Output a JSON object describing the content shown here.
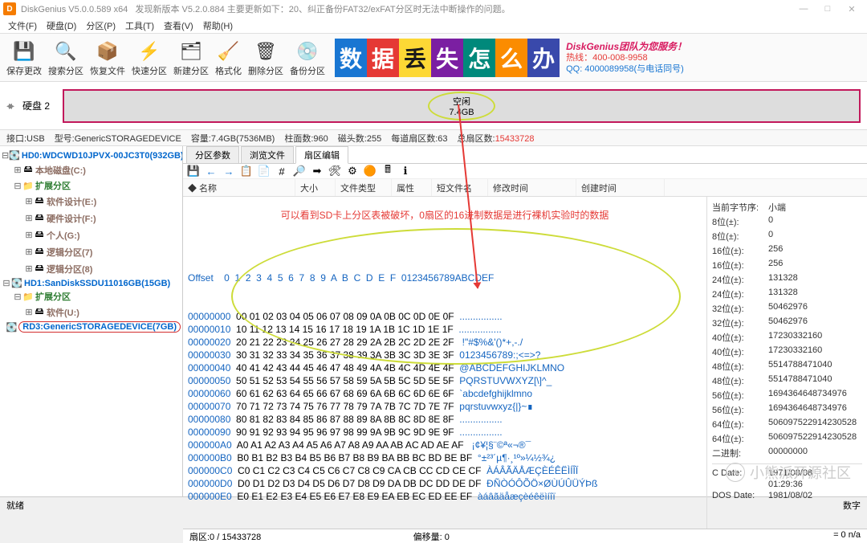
{
  "titlebar": {
    "app": "DiskGenius V5.0.0.589 x64",
    "msg": "发现新版本 V5.2.0.884 主要更新如下：20、纠正备份FAT32/exFAT分区时无法中断操作的问题。"
  },
  "winbtns": {
    "min": "—",
    "max": "□",
    "close": "✕"
  },
  "menu": [
    "文件(F)",
    "硬盘(D)",
    "分区(P)",
    "工具(T)",
    "查看(V)",
    "帮助(H)"
  ],
  "toolbar": [
    {
      "ico": "💾",
      "lbl": "保存更改"
    },
    {
      "ico": "🔍",
      "lbl": "搜索分区"
    },
    {
      "ico": "📦",
      "lbl": "恢复文件"
    },
    {
      "ico": "⚡",
      "lbl": "快速分区"
    },
    {
      "ico": "🗂",
      "lbl": "新建分区"
    },
    {
      "ico": "🧹",
      "lbl": "格式化"
    },
    {
      "ico": "🗑",
      "lbl": "删除分区"
    },
    {
      "ico": "💿",
      "lbl": "备份分区"
    }
  ],
  "banner": {
    "blocks": [
      {
        "bg": "#1976d2",
        "t": "数"
      },
      {
        "bg": "#e53935",
        "t": "据"
      },
      {
        "bg": "#fdd835",
        "t": "丢",
        "fg": "#1a1a1a"
      },
      {
        "bg": "#7b1fa2",
        "t": "失"
      },
      {
        "bg": "#00897b",
        "t": "怎"
      },
      {
        "bg": "#fb8c00",
        "t": "么"
      },
      {
        "bg": "#3949ab",
        "t": "办"
      }
    ],
    "line1": "DiskGenius团队为您服务！",
    "hot": "热线：400-008-9958",
    "qq": "QQ: 4000089958(与电话同号)"
  },
  "diskrow": {
    "label": "硬盘 2",
    "free_t": "空闲",
    "free_s": "7.4GB"
  },
  "infoline": {
    "iface": "接口:USB",
    "model": "型号:GenericSTORAGEDEVICE",
    "cap": "容量:7.4GB(7536MB)",
    "cyl": "柱面数:960",
    "head": "磁头数:255",
    "sec": "每道扇区数:63",
    "tot_l": "总扇区数:",
    "tot_v": "15433728"
  },
  "tree": {
    "hd0": "HD0:WDCWD10JPVX-00JC3T0(932GB)",
    "local": "本地磁盘(C:)",
    "ext1": "扩展分区",
    "e": "软件设计(E:)",
    "f": "硬件设计(F:)",
    "g": "个人(G:)",
    "l7": "逻辑分区(7)",
    "l8": "逻辑分区(8)",
    "hd1": "HD1:SanDiskSSDU11016GB(15GB)",
    "ext2": "扩展分区",
    "u": "软件(U:)",
    "rd3": "RD3:GenericSTORAGEDEVICE(7GB)"
  },
  "tabs": [
    "分区参数",
    "浏览文件",
    "扇区编辑"
  ],
  "cols": [
    "◆ 名称",
    "大小",
    "文件类型",
    "属性",
    "短文件名",
    "修改时间",
    "创建时间"
  ],
  "note": "可以看到SD卡上分区表被破坏，0扇区的16进制数据是进行裸机实验时的数据",
  "hex": {
    "hdr": "Offset    0  1  2  3  4  5  6  7  8  9  A  B  C  D  E  F  0123456789ABCDEF",
    "rows": [
      {
        "o": "00000000",
        "h": "00 01 02 03 04 05 06 07 08 09 0A 0B 0C 0D 0E 0F",
        "a": "................"
      },
      {
        "o": "00000010",
        "h": "10 11 12 13 14 15 16 17 18 19 1A 1B 1C 1D 1E 1F",
        "a": "................"
      },
      {
        "o": "00000020",
        "h": "20 21 22 23 24 25 26 27 28 29 2A 2B 2C 2D 2E 2F",
        "a": " !\"#$%&'()*+,-./"
      },
      {
        "o": "00000030",
        "h": "30 31 32 33 34 35 36 37 38 39 3A 3B 3C 3D 3E 3F",
        "a": "0123456789:;<=>?"
      },
      {
        "o": "00000040",
        "h": "40 41 42 43 44 45 46 47 48 49 4A 4B 4C 4D 4E 4F",
        "a": "@ABCDEFGHIJKLMNO"
      },
      {
        "o": "00000050",
        "h": "50 51 52 53 54 55 56 57 58 59 5A 5B 5C 5D 5E 5F",
        "a": "PQRSTUVWXYZ[\\]^_"
      },
      {
        "o": "00000060",
        "h": "60 61 62 63 64 65 66 67 68 69 6A 6B 6C 6D 6E 6F",
        "a": "`abcdefghijklmno"
      },
      {
        "o": "00000070",
        "h": "70 71 72 73 74 75 76 77 78 79 7A 7B 7C 7D 7E 7F",
        "a": "pqrstuvwxyz{|}~∎"
      },
      {
        "o": "00000080",
        "h": "80 81 82 83 84 85 86 87 88 89 8A 8B 8C 8D 8E 8F",
        "a": "................"
      },
      {
        "o": "00000090",
        "h": "90 91 92 93 94 95 96 97 98 99 9A 9B 9C 9D 9E 9F",
        "a": "................"
      },
      {
        "o": "000000A0",
        "h": "A0 A1 A2 A3 A4 A5 A6 A7 A8 A9 AA AB AC AD AE AF",
        "a": " ¡¢¥¦§¨©ª«¬­®¯"
      },
      {
        "o": "000000B0",
        "h": "B0 B1 B2 B3 B4 B5 B6 B7 B8 B9 BA BB BC BD BE BF",
        "a": "°±²³´µ¶·¸¹º»¼½¾¿"
      },
      {
        "o": "000000C0",
        "h": "C0 C1 C2 C3 C4 C5 C6 C7 C8 C9 CA CB CC CD CE CF",
        "a": "ÀÁÂÃÄÅÆÇÈÉÊËÌÍÎÏ"
      },
      {
        "o": "000000D0",
        "h": "D0 D1 D2 D3 D4 D5 D6 D7 D8 D9 DA DB DC DD DE DF",
        "a": "ÐÑÒÓÔÕÖ×ØÙÚÛÜÝÞß"
      },
      {
        "o": "000000E0",
        "h": "E0 E1 E2 E3 E4 E5 E6 E7 E8 E9 EA EB EC ED EE EF",
        "a": "àáâãäåæçèéêëìíîï"
      }
    ]
  },
  "side": {
    "order_l": "当前字节序:",
    "order_v": "小端",
    "rows": [
      [
        "8位(±):",
        "0"
      ],
      [
        "8位(±):",
        "0"
      ],
      [
        "16位(±):",
        "256"
      ],
      [
        "16位(±):",
        "256"
      ],
      [
        "24位(±):",
        "131328"
      ],
      [
        "24位(±):",
        "131328"
      ],
      [
        "32位(±):",
        "50462976"
      ],
      [
        "32位(±):",
        "50462976"
      ],
      [
        "40位(±):",
        "17230332160"
      ],
      [
        "40位(±):",
        "17230332160"
      ],
      [
        "48位(±):",
        "5514788471040"
      ],
      [
        "48位(±):",
        "5514788471040"
      ],
      [
        "56位(±):",
        "1694364648734976"
      ],
      [
        "56位(±):",
        "1694364648734976"
      ],
      [
        "64位(±):",
        "506097522914230528"
      ],
      [
        "64位(±):",
        "506097522914230528"
      ],
      [
        "二进制:",
        "00000000"
      ]
    ],
    "cdate_l": "C Date:",
    "cdate_v": "1971/08/08",
    "ctime": "01:29:36",
    "ddate_l": "DOS Date:",
    "ddate_v": "1981/08/02"
  },
  "status1": {
    "sec": "扇区:0 / 15433728",
    "off": "偏移量: 0",
    "na": "= 0 n/a"
  },
  "statusbar": {
    "ready": "就绪",
    "num": "数字"
  },
  "watermark": "小熊派开源社区"
}
